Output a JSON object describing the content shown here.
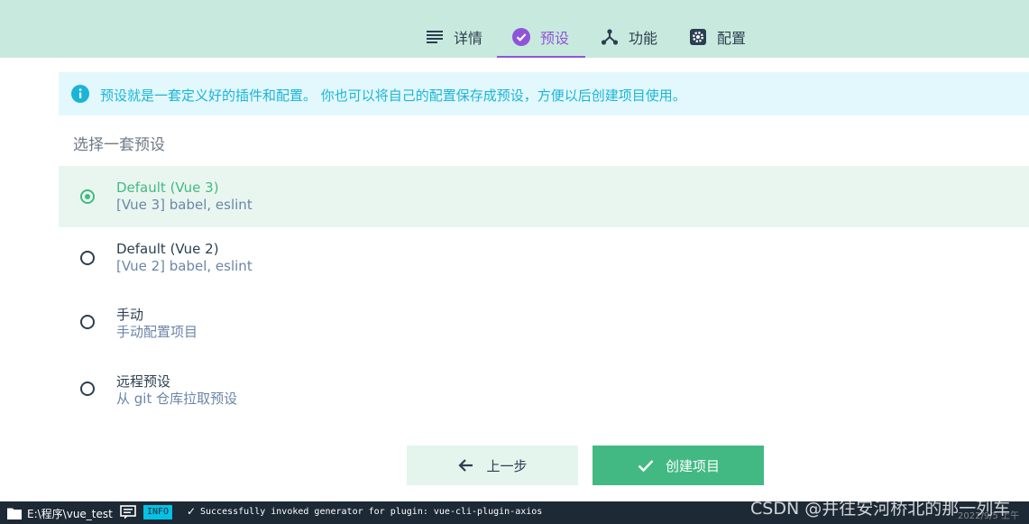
{
  "nav": {
    "tabs": [
      {
        "label": "详情",
        "icon": "list-icon"
      },
      {
        "label": "预设",
        "icon": "check-circle-icon",
        "active": true
      },
      {
        "label": "功能",
        "icon": "fork-icon"
      },
      {
        "label": "配置",
        "icon": "gear-icon"
      }
    ]
  },
  "info_banner": {
    "text": "预设就是一套定义好的插件和配置。 你也可以将自己的配置保存成预设，方便以后创建项目使用。"
  },
  "section_title": "选择一套预设",
  "presets": [
    {
      "name": "Default (Vue 3)",
      "desc": "[Vue 3] babel, eslint",
      "selected": true
    },
    {
      "name": "Default (Vue 2)",
      "desc": "[Vue 2] babel, eslint",
      "selected": false
    },
    {
      "name": "手动",
      "desc": "手动配置项目",
      "selected": false
    },
    {
      "name": "远程预设",
      "desc": "从 git 仓库拉取预设",
      "selected": false
    }
  ],
  "buttons": {
    "prev_label": "上一步",
    "create_label": "创建项目"
  },
  "statusbar": {
    "path": "E:\\程序\\vue_test",
    "badge": "INFO",
    "check": "✓",
    "message": "Successfully invoked generator for plugin: vue-cli-plugin-axios",
    "watermark": "CSDN @井往安河桥北的那一列车",
    "date": "2022/9/5 上午"
  },
  "colors": {
    "accent": "#42b983",
    "tab_active": "#8f55d9",
    "topbar": "#c8eade",
    "info_text": "#1ab5d6",
    "statusbar": "#1d2935"
  }
}
